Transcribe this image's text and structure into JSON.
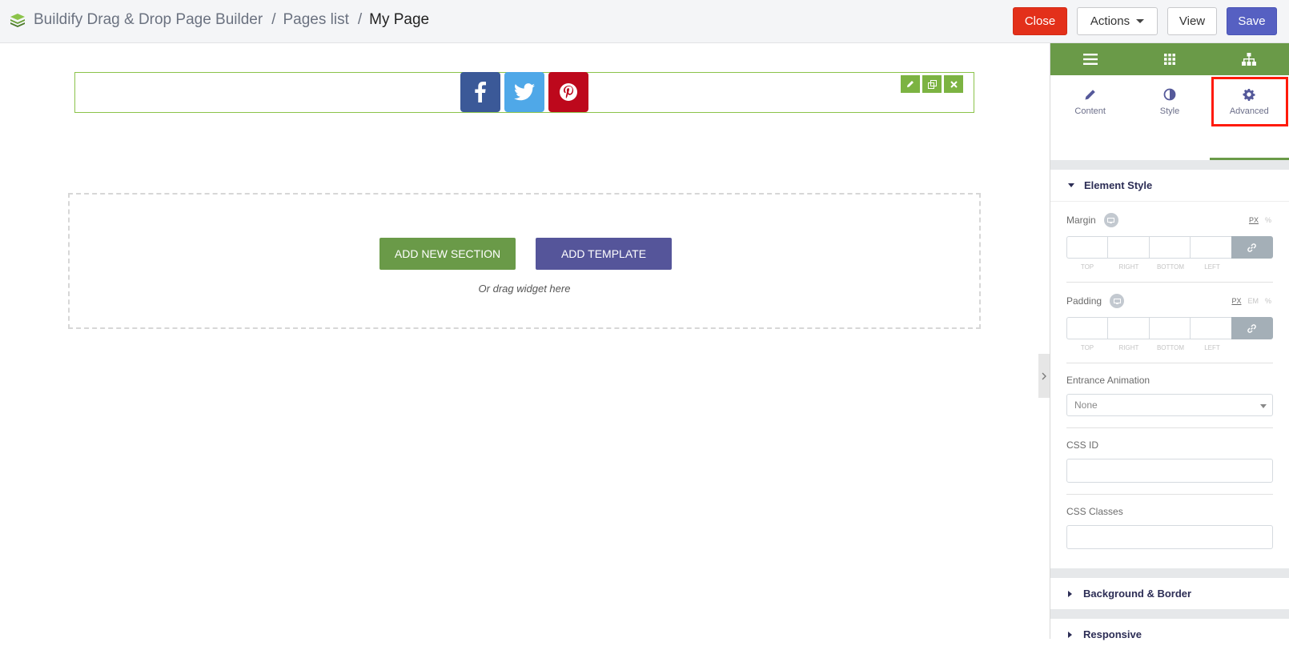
{
  "header": {
    "app_title": "Buildify Drag & Drop Page Builder",
    "breadcrumb": [
      "Pages list",
      "My Page"
    ],
    "separator": "/",
    "close_label": "Close",
    "actions_label": "Actions",
    "view_label": "View",
    "save_label": "Save",
    "colors": {
      "close": "#e3301a",
      "save": "#5660c2"
    }
  },
  "canvas": {
    "social_icons": [
      "facebook-icon",
      "twitter-icon",
      "pinterest-icon"
    ],
    "add_section_label": "ADD NEW SECTION",
    "add_template_label": "ADD TEMPLATE",
    "drag_hint": "Or drag widget here"
  },
  "panel": {
    "nav_icons": [
      "menu-icon",
      "widgets-grid-icon",
      "navigator-icon"
    ],
    "tabs": [
      {
        "label": "Content",
        "icon": "pencil-icon"
      },
      {
        "label": "Style",
        "icon": "contrast-icon"
      },
      {
        "label": "Advanced",
        "icon": "gear-icon",
        "active": true
      }
    ],
    "section_element_style": "Element Style",
    "margin": {
      "label": "Margin",
      "units": [
        "PX",
        "%"
      ]
    },
    "padding": {
      "label": "Padding",
      "units": [
        "PX",
        "EM",
        "%"
      ]
    },
    "dim_labels": [
      "TOP",
      "RIGHT",
      "BOTTOM",
      "LEFT"
    ],
    "entrance_animation": {
      "label": "Entrance Animation",
      "value": "None"
    },
    "css_id": {
      "label": "CSS ID",
      "value": ""
    },
    "css_classes": {
      "label": "CSS Classes",
      "value": ""
    },
    "section_background": "Background & Border",
    "section_responsive": "Responsive",
    "accent_color": "#6a9a48"
  }
}
